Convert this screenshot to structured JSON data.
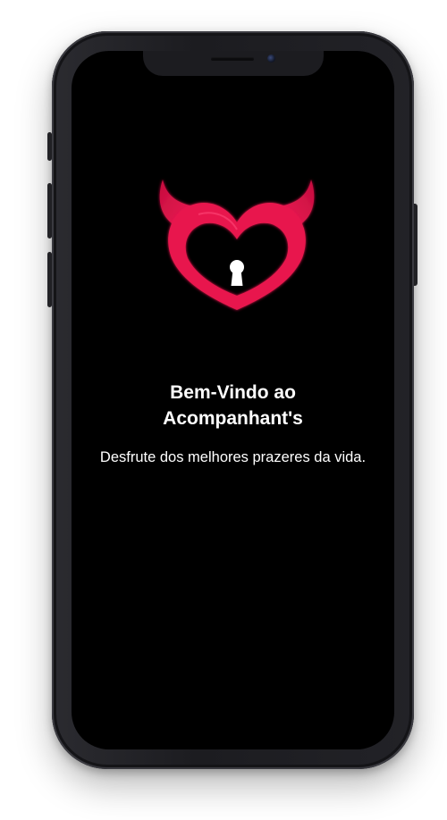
{
  "welcome": {
    "title_line1": "Bem-Vindo ao",
    "title_line2": "Acompanhant's",
    "subtitle": "Desfrute dos melhores prazeres da vida."
  },
  "logo": {
    "icon": "devil-heart-keyhole-icon",
    "color": "#e8164e"
  },
  "theme": {
    "screen_background": "#000000",
    "text_color": "#ffffff"
  }
}
